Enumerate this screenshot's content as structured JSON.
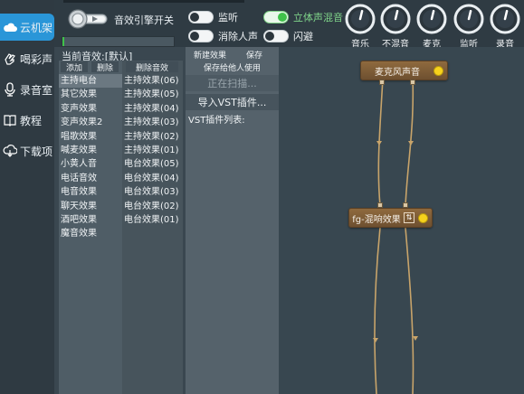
{
  "sidebar": {
    "items": [
      {
        "label": "云机架",
        "icon": "cloud-icon",
        "active": true
      },
      {
        "label": "喝彩声",
        "icon": "clap-hand-icon",
        "active": false
      },
      {
        "label": "录音室",
        "icon": "microphone-icon",
        "active": false
      },
      {
        "label": "教程",
        "icon": "book-icon",
        "active": false
      },
      {
        "label": "下载项",
        "icon": "cloud-download-icon",
        "active": false
      }
    ]
  },
  "engine": {
    "label": "音效引擎开关",
    "progress": 0.02
  },
  "toggles": {
    "monitor": {
      "label": "监听",
      "on": false
    },
    "vocal_remove": {
      "label": "消除人声",
      "on": false
    },
    "stereo_mix": {
      "label": "立体声混音",
      "on": true
    },
    "dodge": {
      "label": "闪避",
      "on": false
    }
  },
  "knobs": [
    {
      "label": "音乐",
      "level": 0.55
    },
    {
      "label": "不混音",
      "level": 0.55
    },
    {
      "label": "麦克",
      "level": 0.55
    },
    {
      "label": "监听",
      "level": 0.55
    },
    {
      "label": "录音",
      "level": 0.55
    }
  ],
  "current_effect": "当前音效:[默认]",
  "col1": {
    "add_label": "添加",
    "delete_label": "删除",
    "items": [
      "主持电台",
      "其它效果",
      "变声效果",
      "变声效果2",
      "唱歌效果",
      "喊麦效果",
      "小黄人音",
      "电话音效",
      "电音效果",
      "聊天效果",
      "酒吧效果",
      "魔音效果"
    ],
    "selected_index": 0
  },
  "col2": {
    "delete_label": "删除音效",
    "items": [
      "主持效果(06)",
      "主持效果(05)",
      "主持效果(04)",
      "主持效果(03)",
      "主持效果(02)",
      "主持效果(01)",
      "电台效果(05)",
      "电台效果(04)",
      "电台效果(03)",
      "电台效果(02)",
      "电台效果(01)"
    ]
  },
  "col3": {
    "new_effect_label": "新建效果",
    "save_label": "保存",
    "share_label": "保存给他人使用",
    "scanning_label": "正在扫描...",
    "import_vst_label": "导入VST插件...",
    "vst_list_label": "VST插件列表:"
  },
  "graph": {
    "nodes": [
      {
        "label": "麦克风声音",
        "icon": "status-dot-icon"
      },
      {
        "label": "fg-混响效果",
        "icon": "settings-icon"
      }
    ]
  },
  "colors": {
    "accent": "#2a96d8",
    "toggle_on": "#3fc24a",
    "node": "#7d5c36",
    "node_dot": "#f7d21c",
    "wire": "#c8a46a"
  }
}
